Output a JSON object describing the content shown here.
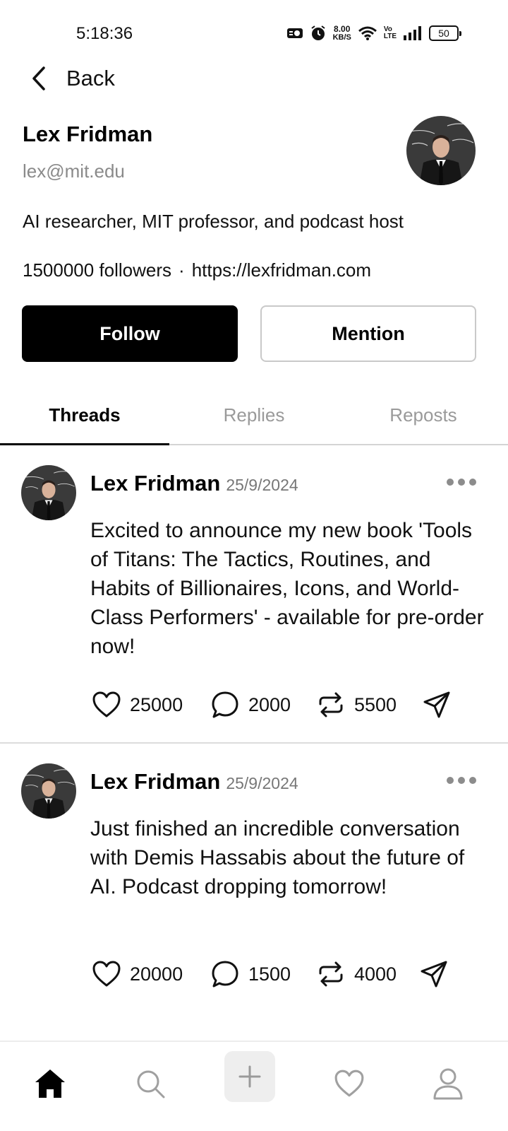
{
  "status_bar": {
    "time": "5:18:36",
    "net_speed_value": "8.00",
    "net_speed_unit": "KB/S",
    "volte_top": "Vo",
    "volte_bottom": "LTE",
    "battery": "50"
  },
  "nav": {
    "back_label": "Back"
  },
  "profile": {
    "name": "Lex Fridman",
    "handle": "lex@mit.edu",
    "bio": "AI researcher, MIT professor, and podcast host",
    "followers": "1500000 followers",
    "separator": "·",
    "website": "https://lexfridman.com",
    "follow_label": "Follow",
    "mention_label": "Mention"
  },
  "tabs": [
    {
      "label": "Threads",
      "active": true
    },
    {
      "label": "Replies",
      "active": false
    },
    {
      "label": "Reposts",
      "active": false
    }
  ],
  "posts": [
    {
      "author": "Lex Fridman",
      "date": "25/9/2024",
      "text": "Excited to announce my new book 'Tools of Titans: The Tactics, Routines, and Habits of Billionaires, Icons, and World-Class Performers' - available for pre-order now!",
      "likes": "25000",
      "comments": "2000",
      "reposts": "5500"
    },
    {
      "author": "Lex Fridman",
      "date": "25/9/2024",
      "text": "Just finished an incredible conversation with Demis Hassabis about the future of AI. Podcast dropping tomorrow!",
      "likes": "20000",
      "comments": "1500",
      "reposts": "4000"
    }
  ],
  "bottom_nav": [
    "home-icon",
    "search-icon",
    "plus-icon",
    "heart-icon",
    "profile-icon"
  ]
}
